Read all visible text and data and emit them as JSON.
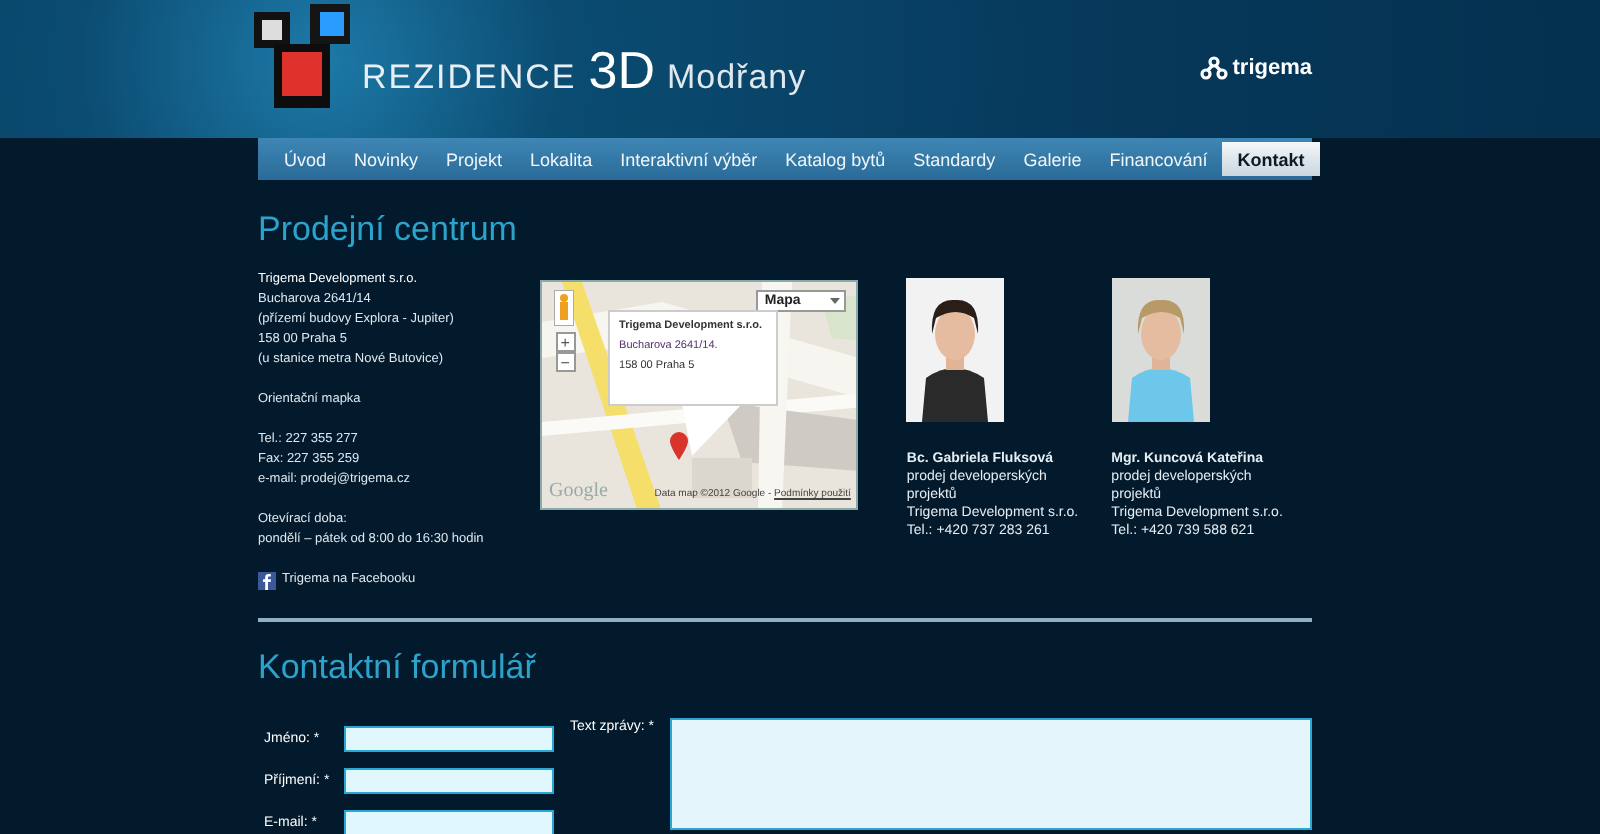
{
  "header": {
    "logo_title": "REZIDENCE",
    "logo_3d": "3D",
    "logo_place": "Modřany",
    "partner": "trigema"
  },
  "nav": [
    {
      "label": "Úvod",
      "selected": false
    },
    {
      "label": "Novinky",
      "selected": false
    },
    {
      "label": "Projekt",
      "selected": false
    },
    {
      "label": "Lokalita",
      "selected": false
    },
    {
      "label": "Interaktivní výběr",
      "selected": false
    },
    {
      "label": "Katalog bytů",
      "selected": false
    },
    {
      "label": "Standardy",
      "selected": false
    },
    {
      "label": "Galerie",
      "selected": false
    },
    {
      "label": "Financování",
      "selected": false
    },
    {
      "label": "Kontakt",
      "selected": true
    }
  ],
  "sales": {
    "heading": "Prodejní centrum",
    "company": "Trigema Development s.r.o.",
    "address_lines": [
      "Bucharova 2641/14",
      "(přízemí budovy Explora - Jupiter)",
      "158 00 Praha 5",
      "(u stanice metra Nové Butovice)"
    ],
    "map_link": "Orientační mapka",
    "contacts": [
      "Tel.: 227 355 277",
      "Fax: 227 355 259",
      "e-mail: prodej@trigema.cz"
    ],
    "hours_label": "Otevírací doba:",
    "hours": "pondělí – pátek od 8:00 do 16:30 hodin",
    "facebook": "Trigema na Facebooku"
  },
  "map": {
    "type_select": "Mapa",
    "zoom_in": "+",
    "zoom_out": "−",
    "popup": [
      "Trigema Development s.r.o.",
      "Bucharova 2641/14.",
      "158 00 Praha 5"
    ],
    "brand": "Google",
    "attribution": "Data map ©2012 Google - ",
    "terms_link": "Podmínky použití"
  },
  "people": [
    {
      "name": "Bc. Gabriela Fluksová",
      "role": "prodej developerských projektů",
      "company": "Trigema Development s.r.o.",
      "phone": "Tel.: +420 737 283 261"
    },
    {
      "name": "Mgr. Kuncová Kateřina",
      "role": "prodej developerských projektů",
      "company": "Trigema Development s.r.o.",
      "phone": "Tel.: +420 739 588 621"
    }
  ],
  "form": {
    "heading": "Kontaktní formulář",
    "fields": [
      {
        "label": "Jméno: *"
      },
      {
        "label": "Příjmení: *"
      },
      {
        "label": "E-mail: *"
      }
    ],
    "message_label": "Text zprávy: *"
  }
}
